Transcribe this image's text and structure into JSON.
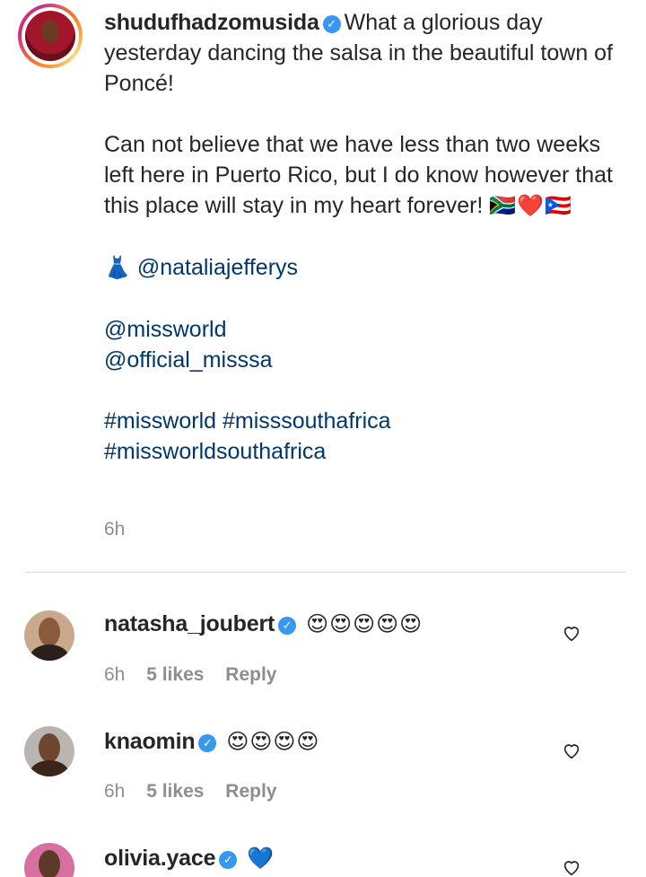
{
  "post": {
    "username": "shudufhadzomusida",
    "caption_line1": "What a glorious day yesterday dancing the salsa in the beautiful town of Poncé!",
    "caption_line2": "Can not believe that we have less than two weeks left here in Puerto Rico, but I do know however that this place will stay in my heart forever!",
    "caption_emojis": "🇿🇦❤️🇵🇷",
    "dress_emoji": "👗",
    "mention_designer": "@nataliajefferys",
    "mention_missworld": "@missworld",
    "mention_misssa": "@official_misssa",
    "hashtags_line1": "#missworld #misssouthafrica",
    "hashtags_line2": "#missworldsouthafrica",
    "time": "6h"
  },
  "verified_glyph": "✓",
  "comments": [
    {
      "username": "natasha_joubert",
      "text": "😍😍😍😍😍",
      "time": "6h",
      "likes": "5 likes",
      "reply": "Reply"
    },
    {
      "username": "knaomin",
      "text": "😍😍😍😍",
      "time": "6h",
      "likes": "5 likes",
      "reply": "Reply"
    },
    {
      "username": "olivia.yace",
      "text": "💙",
      "time": "",
      "likes": "",
      "reply": ""
    }
  ],
  "colors": {
    "text": "#262626",
    "muted": "#8e8e8e",
    "link": "#00376b",
    "verified": "#3897f0",
    "divider": "#dbdbdb"
  }
}
